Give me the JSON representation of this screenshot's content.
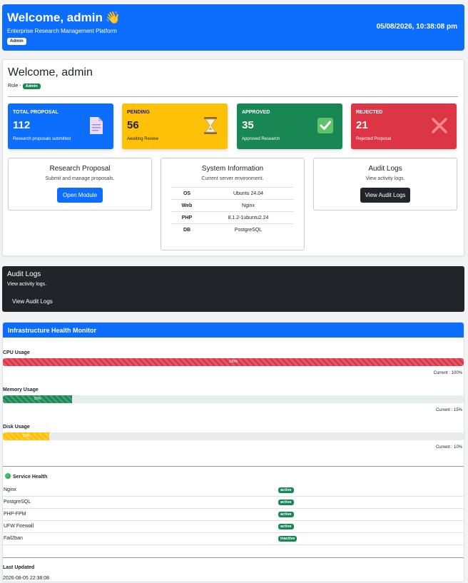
{
  "header": {
    "title": "Welcome, admin",
    "wave": "👋",
    "subtitle": "Enterprise Research Management Platform",
    "badge": "Admin",
    "datetime": "05/08/2026, 10:38:08 pm"
  },
  "main": {
    "welcome": "Welcome, admin",
    "role_label": "Role -",
    "role_badge": "Admin"
  },
  "stats": [
    {
      "label": "TOTAL PROPOSAL",
      "value": "112",
      "desc": "Research proposals submitted",
      "color": "#0d6efd",
      "icon": "document-icon"
    },
    {
      "label": "PENDING",
      "value": "56",
      "desc": "Awaiting Review",
      "color": "#ffc107",
      "icon": "hourglass-icon"
    },
    {
      "label": "APPROVED",
      "value": "35",
      "desc": "Approved Research",
      "color": "#198754",
      "icon": "check-icon"
    },
    {
      "label": "REJECTED",
      "value": "21",
      "desc": "Rejected Proposal",
      "color": "#dc3545",
      "icon": "cross-icon"
    }
  ],
  "modules": {
    "research": {
      "title": "Research Proposal",
      "desc": "Submit and manage proposals.",
      "button": "Open Module"
    },
    "system": {
      "title": "System Information",
      "desc": "Current server environment.",
      "rows": [
        {
          "key": "OS",
          "value": "Ubuntu 24.04"
        },
        {
          "key": "Web",
          "value": "Nginx"
        },
        {
          "key": "PHP",
          "value": "8.1.2-1ubuntu2.24"
        },
        {
          "key": "DB",
          "value": "PostgreSQL"
        }
      ]
    },
    "audit": {
      "title": "Audit Logs",
      "desc": "View activity logs.",
      "button": "View Audit Logs"
    }
  },
  "audit_banner": {
    "title": "Audit Logs",
    "desc": "View activity logs.",
    "button": "View Audit Logs"
  },
  "health": {
    "title": "Infrastructure Health Monitor",
    "metrics": [
      {
        "label": "CPU Usage",
        "percent": 100,
        "bar_text": "100%",
        "current": "Current : 100%",
        "color": "#dc3545"
      },
      {
        "label": "Memory Usage",
        "percent": 15,
        "bar_text": "15%",
        "current": "Current : 15%",
        "color": "#198754"
      },
      {
        "label": "Disk Usage",
        "percent": 10,
        "bar_text": "10%",
        "current": "Current : 10%",
        "color": "#ffc107"
      }
    ],
    "service_title": "Service Health",
    "services": [
      {
        "name": "Nginx",
        "status": "active"
      },
      {
        "name": "PostgreSQL",
        "status": "active"
      },
      {
        "name": "PHP-FPM",
        "status": "active"
      },
      {
        "name": "UFW Firewall",
        "status": "active"
      },
      {
        "name": "Fail2ban",
        "status": "inactive"
      }
    ],
    "last_updated_label": "Last Updated",
    "last_updated": "2026-08-05 22:38:08"
  }
}
